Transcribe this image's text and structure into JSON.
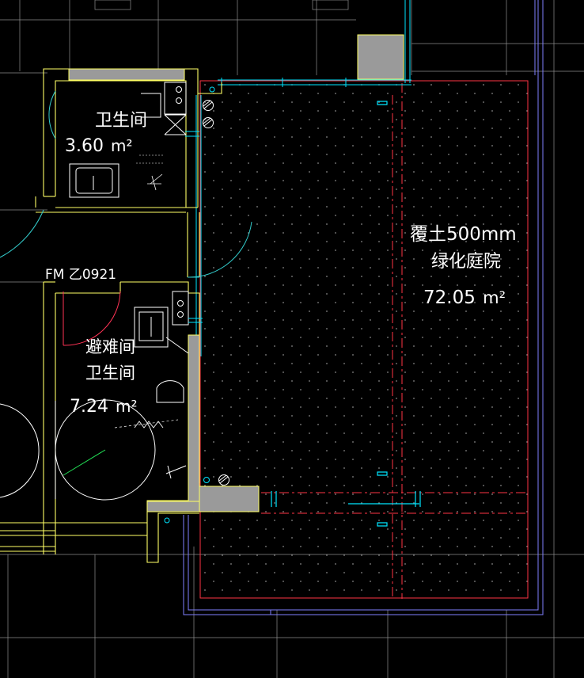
{
  "drawing": {
    "background": "#000000",
    "colors": {
      "wall": "#ffff66",
      "grid": "#ffffff",
      "door": "#33cccc",
      "red": "#ff3344",
      "blue": "#8888ff",
      "cyan": "#00e5ff",
      "fill": "#9a9a9a",
      "text": "#ffffff"
    },
    "rooms": {
      "bathroom1": {
        "name": "卫生间",
        "area": "3.60",
        "unit": "m²"
      },
      "door_tag": "FM 乙0921",
      "accessible_bathroom": {
        "name_line1": "避难间",
        "name_line2": "卫生间",
        "area": "7.24",
        "unit": "m²"
      },
      "garden": {
        "soil": "覆土500mm",
        "name": "绿化庭院",
        "area": "72.05",
        "unit": "m²"
      }
    }
  }
}
